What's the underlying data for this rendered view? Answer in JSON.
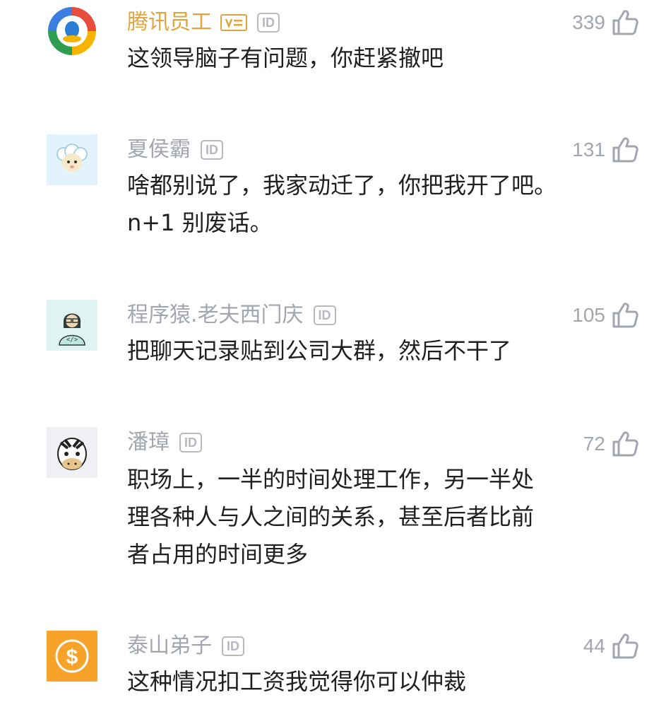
{
  "comments": [
    {
      "username": "腾讯员工",
      "id_badge": "ID",
      "likes": "339",
      "text": "这领导脑子有问题，你赶紧撤吧",
      "avatar_icon": "tencent-news-logo-icon",
      "verified_badge_icon": "v-verified-icon"
    },
    {
      "username": "夏侯霸",
      "id_badge": "ID",
      "likes": "131",
      "text": "啥都别说了，我家动迁了，你把我开了吧。n+1 别废话。",
      "avatar_icon": "sheep-avatar-icon"
    },
    {
      "username": "程序猿.老夫西门庆",
      "id_badge": "ID",
      "likes": "105",
      "text": "把聊天记录贴到公司大群，然后不干了",
      "avatar_icon": "programmer-avatar-icon"
    },
    {
      "username": "潘璋",
      "id_badge": "ID",
      "likes": "72",
      "text": "职场上，一半的时间处理工作，另一半处理各种人与人之间的关系，甚至后者比前者占用的时间更多",
      "avatar_icon": "zebra-avatar-icon"
    },
    {
      "username": "泰山弟子",
      "id_badge": "ID",
      "likes": "44",
      "text": "这种情况扣工资我觉得你可以仲裁",
      "avatar_icon": "dollar-avatar-icon"
    }
  ],
  "colors": {
    "username": "#a1a6b1",
    "staff_username": "#e2a43d",
    "text": "#1f1f1f",
    "like": "#a1a6b1"
  }
}
